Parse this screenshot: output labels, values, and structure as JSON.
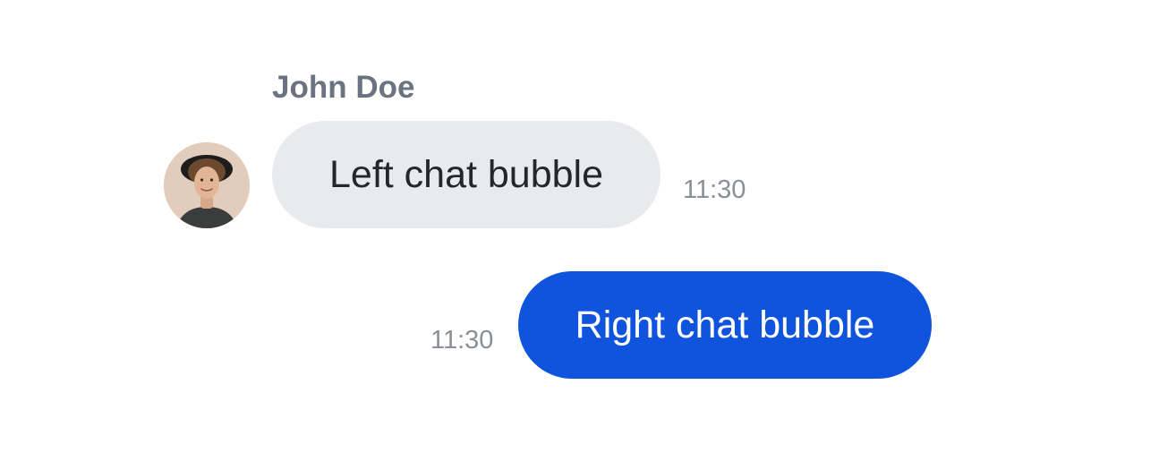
{
  "colors": {
    "left_bubble_bg": "#e9eaee",
    "left_bubble_text": "#23262b",
    "right_bubble_bg": "#1054dd",
    "right_bubble_text": "#ffffff",
    "sender_name": "#6b7280",
    "timestamp": "#8a8f98"
  },
  "conversation": {
    "incoming": {
      "sender_name": "John Doe",
      "avatar_icon": "user-avatar-photo",
      "text": "Left chat bubble",
      "time": "11:30"
    },
    "outgoing": {
      "text": "Right chat bubble",
      "time": "11:30"
    }
  }
}
